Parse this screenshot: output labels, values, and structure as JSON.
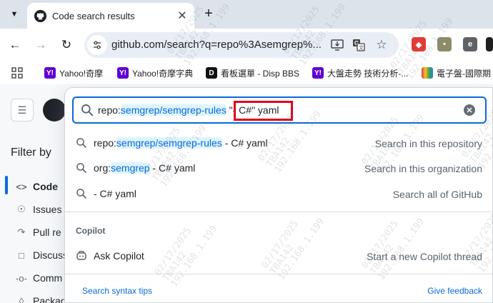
{
  "browser": {
    "tab_title": "Code search results",
    "url": "github.com/search?q=repo%3Asemgrep%..."
  },
  "bookmarks": [
    {
      "label": "Yahoo!奇摩",
      "icon": "yahoo-icon"
    },
    {
      "label": "Yahoo!奇摩字典",
      "icon": "yahoo-icon"
    },
    {
      "label": "看板選單 - Disp BBS",
      "icon": "disp-bbs-icon"
    },
    {
      "label": "大盤走勢 技術分析-...",
      "icon": "yahoo-icon"
    },
    {
      "label": "電子盤-國際期",
      "icon": "rainbow-icon"
    }
  ],
  "sidebar": {
    "filter_title": "Filter by",
    "items": [
      {
        "label": "Code",
        "icon": "code-icon"
      },
      {
        "label": "Issues",
        "icon": "issue-icon"
      },
      {
        "label": "Pull re",
        "icon": "pull-request-icon"
      },
      {
        "label": "Discuss",
        "icon": "discussion-icon"
      },
      {
        "label": "Comm",
        "icon": "commit-icon"
      },
      {
        "label": "Packag",
        "icon": "package-icon"
      }
    ]
  },
  "search": {
    "query_prefix": "repo:",
    "query_repo": "semgrep/semgrep-rules",
    "query_rest": " \"- C#\" yaml"
  },
  "suggestions": [
    {
      "prefix": "repo:",
      "highlight": "semgrep/semgrep-rules",
      "rest": " - C# yaml",
      "hint": "Search in this repository"
    },
    {
      "prefix": "org:",
      "highlight": "semgrep",
      "rest": " - C# yaml",
      "hint": "Search in this organization"
    },
    {
      "prefix": "",
      "highlight": "",
      "rest": "- C# yaml",
      "hint": "Search all of GitHub"
    }
  ],
  "copilot": {
    "section_label": "Copilot",
    "label": "Ask Copilot",
    "hint": "Start a new Copilot thread"
  },
  "footer": {
    "left": "Search syntax tips",
    "right": "Give feedback"
  },
  "watermark": {
    "date": "02/17/2025",
    "user": "TBA142",
    "ip": "192.168.1.199"
  },
  "colors": {
    "accent": "#0969da",
    "highlight_bg": "#ddf4ff",
    "annotation_red": "#e0001b"
  }
}
